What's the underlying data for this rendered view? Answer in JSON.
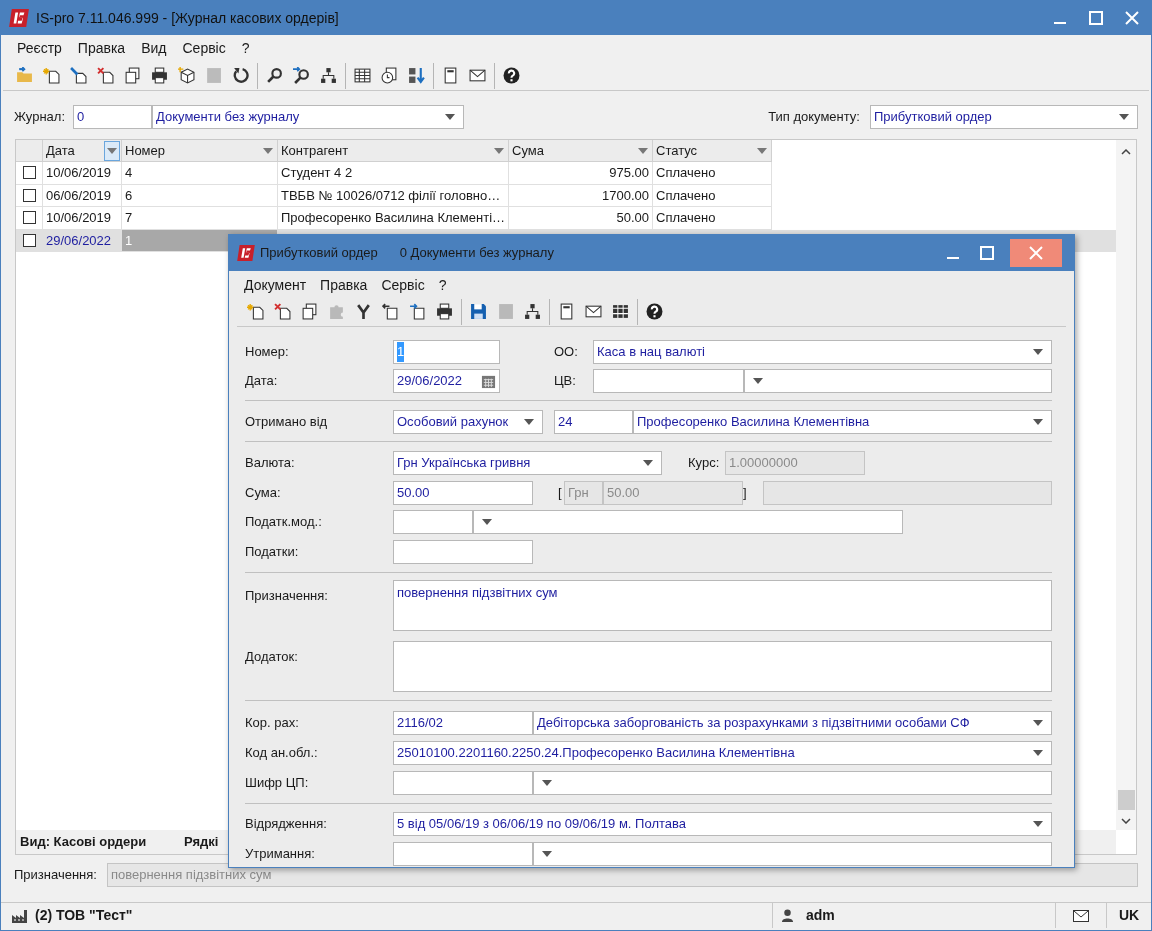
{
  "window": {
    "title": "IS-pro 7.11.046.999 - [Журнал касових ордерів]"
  },
  "menu": [
    "Реєстр",
    "Правка",
    "Вид",
    "Сервіс",
    "?"
  ],
  "toolbar": [
    {
      "kind": "folder",
      "disabled": false
    },
    {
      "kind": "new",
      "disabled": false
    },
    {
      "kind": "edit",
      "disabled": false
    },
    {
      "kind": "delete",
      "disabled": false
    },
    {
      "kind": "copy",
      "disabled": false
    },
    {
      "kind": "print",
      "disabled": false
    },
    {
      "kind": "package",
      "disabled": false
    },
    {
      "kind": "square",
      "disabled": true
    },
    {
      "kind": "refresh",
      "disabled": false
    },
    {
      "kind": "separator"
    },
    {
      "kind": "search",
      "disabled": false
    },
    {
      "kind": "search_next",
      "disabled": false
    },
    {
      "kind": "tree",
      "disabled": false
    },
    {
      "kind": "separator"
    },
    {
      "kind": "table",
      "disabled": false
    },
    {
      "kind": "clock",
      "disabled": false
    },
    {
      "kind": "sort",
      "disabled": false
    },
    {
      "kind": "separator"
    },
    {
      "kind": "page",
      "disabled": false
    },
    {
      "kind": "mail",
      "disabled": false
    },
    {
      "kind": "separator"
    },
    {
      "kind": "help",
      "disabled": false
    }
  ],
  "journal": {
    "label": "Журнал:",
    "code": "0",
    "name": "Документи без журналу"
  },
  "doc_type": {
    "label": "Тип документу:",
    "value": "Прибутковий ордер"
  },
  "table": {
    "columns": [
      {
        "label": "Дата",
        "filtered": true,
        "numeric": false
      },
      {
        "label": "Номер",
        "filtered": false,
        "numeric": false
      },
      {
        "label": "Контрагент",
        "filtered": false,
        "numeric": false
      },
      {
        "label": "Сума",
        "filtered": false,
        "numeric": true
      },
      {
        "label": "Статус",
        "filtered": false,
        "numeric": false
      }
    ],
    "rows": [
      {
        "checked": false,
        "selected": false,
        "cells": [
          "10/06/2019",
          "4",
          "Студент 4 2",
          "975.00",
          "Сплачено"
        ]
      },
      {
        "checked": false,
        "selected": false,
        "cells": [
          "06/06/2019",
          "6",
          "ТВБВ № 10026/0712 філії головно…",
          "1700.00",
          "Сплачено"
        ]
      },
      {
        "checked": false,
        "selected": false,
        "cells": [
          "10/06/2019",
          "7",
          "Професоренко Василина Клементі…",
          "50.00",
          "Сплачено"
        ]
      },
      {
        "checked": false,
        "selected": true,
        "cells": [
          "29/06/2022",
          "1"
        ]
      }
    ]
  },
  "footer": {
    "view": "Вид: Касові ордери",
    "rows": "Рядкі"
  },
  "purpose": {
    "label": "Призначення:",
    "value": "повернення підзвітних сум"
  },
  "status_bar": {
    "company": "(2) ТОВ \"Тест\"",
    "user": "adm",
    "language": "UK"
  },
  "dialog": {
    "title": "Прибутковий ордер",
    "subtitle": "0 Документи без журналу",
    "menu": [
      "Документ",
      "Правка",
      "Сервіс",
      "?"
    ],
    "toolbar": [
      {
        "kind": "new",
        "disabled": false
      },
      {
        "kind": "delete",
        "disabled": false
      },
      {
        "kind": "copy",
        "disabled": false
      },
      {
        "kind": "puzzle",
        "disabled": true
      },
      {
        "kind": "merge",
        "disabled": false
      },
      {
        "kind": "import",
        "disabled": false
      },
      {
        "kind": "export",
        "disabled": false
      },
      {
        "kind": "print",
        "disabled": false
      },
      {
        "kind": "separator"
      },
      {
        "kind": "save",
        "disabled": false
      },
      {
        "kind": "square",
        "disabled": true
      },
      {
        "kind": "tree",
        "disabled": false
      },
      {
        "kind": "separator"
      },
      {
        "kind": "page",
        "disabled": false
      },
      {
        "kind": "mail",
        "disabled": false
      },
      {
        "kind": "columns",
        "disabled": false
      },
      {
        "kind": "separator"
      },
      {
        "kind": "help",
        "disabled": false
      }
    ],
    "form": {
      "number": {
        "label": "Номер:",
        "value": "1",
        "focused": true
      },
      "oo": {
        "label": "ОО:",
        "value": "Каса в нац валюті"
      },
      "date": {
        "label": "Дата:",
        "value": "29/06/2022"
      },
      "cv": {
        "label": "ЦВ:"
      },
      "received_from": {
        "label": "Отримано від",
        "type": "Особовий рахунок",
        "code": "24",
        "name": "Професоренко Василина Клементівна"
      },
      "currency": {
        "label": "Валюта:",
        "value": "Грн Українська гривня"
      },
      "rate": {
        "label": "Курс:",
        "value": "1.00000000",
        "disabled": true
      },
      "sum": {
        "label": "Сума:",
        "value": "50.00",
        "open_bracket": "[",
        "close_bracket": "]"
      },
      "converted": {
        "currency": "Грн",
        "value": "50.00",
        "disabled": true
      },
      "extra": {
        "disabled": true
      },
      "tax_mod": {
        "label": "Податк.мод.:"
      },
      "taxes": {
        "label": "Податки:"
      },
      "purpose": {
        "label": "Призначення:",
        "value": "повернення підзвітних сум"
      },
      "attachment": {
        "label": "Додаток:"
      },
      "account": {
        "label": "Кор. рах:",
        "code": "2116/02",
        "name": "Дебіторська заборгованість за розрахунками з підзвітними особами СФ"
      },
      "analytics": {
        "label": "Код ан.обл.:",
        "value": "25010100.2201160.2250.24.Професоренко Василина Клементівна"
      },
      "cp": {
        "label": "Шифр ЦП:"
      },
      "trip": {
        "label": "Відрядження:",
        "value": "5 від 05/06/19 з 06/06/19 по 09/06/19 м. Полтава"
      },
      "deduction": {
        "label": "Утримання:"
      }
    }
  }
}
